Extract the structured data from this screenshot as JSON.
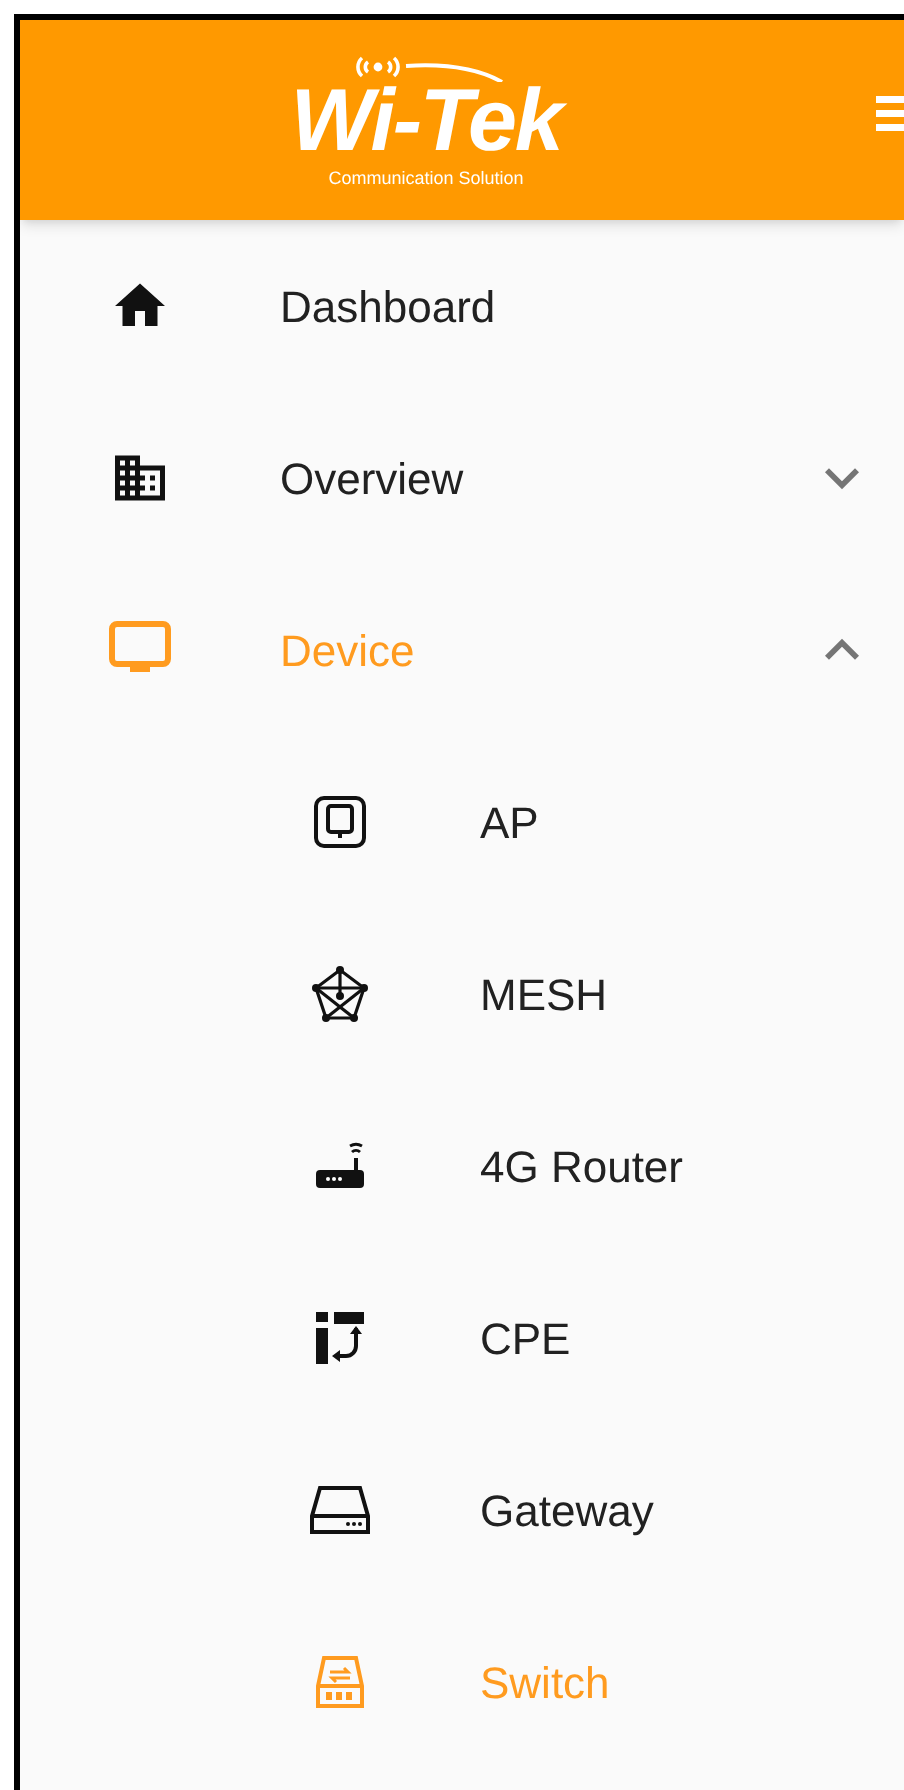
{
  "header": {
    "logo": "Wi-Tek",
    "tagline": "Communication Solution"
  },
  "nav": [
    {
      "label": "Dashboard",
      "selected": false
    },
    {
      "label": "Overview",
      "selected": false,
      "expanded": false
    },
    {
      "label": "Device",
      "selected": true,
      "expanded": true,
      "children": [
        {
          "label": "AP",
          "selected": false
        },
        {
          "label": "MESH",
          "selected": false
        },
        {
          "label": "4G Router",
          "selected": false
        },
        {
          "label": "CPE",
          "selected": false
        },
        {
          "label": "Gateway",
          "selected": false
        },
        {
          "label": "Switch",
          "selected": true
        }
      ]
    }
  ]
}
